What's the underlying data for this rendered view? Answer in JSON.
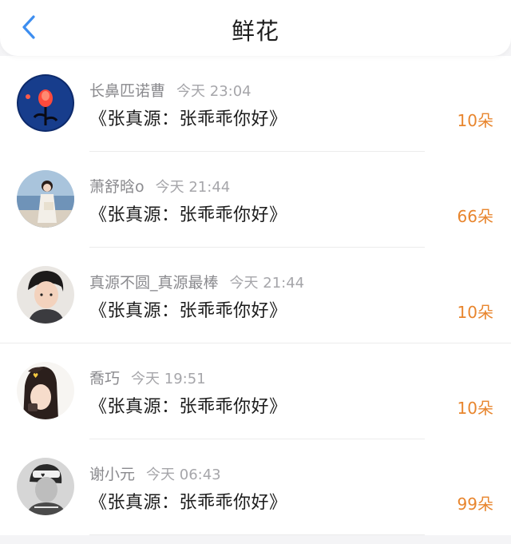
{
  "header": {
    "title": "鲜花"
  },
  "items": [
    {
      "name": "长鼻匹诺曹",
      "time": "今天 23:04",
      "message": "《张真源：张乖乖你好》",
      "count": "10朵"
    },
    {
      "name": "萧舒晗o",
      "time": "今天 21:44",
      "message": "《张真源：张乖乖你好》",
      "count": "66朵"
    },
    {
      "name": "真源不圆_真源最棒",
      "time": "今天 21:44",
      "message": "《张真源：张乖乖你好》",
      "count": "10朵"
    },
    {
      "name": "喬巧",
      "time": "今天 19:51",
      "message": "《张真源：张乖乖你好》",
      "count": "10朵"
    },
    {
      "name": "谢小元",
      "time": "今天 06:43",
      "message": "《张真源：张乖乖你好》",
      "count": "99朵"
    }
  ],
  "colors": {
    "accent": "#e8852d",
    "back_icon": "#3d8ef0"
  },
  "icons": {
    "back": "chevron-left-icon"
  }
}
